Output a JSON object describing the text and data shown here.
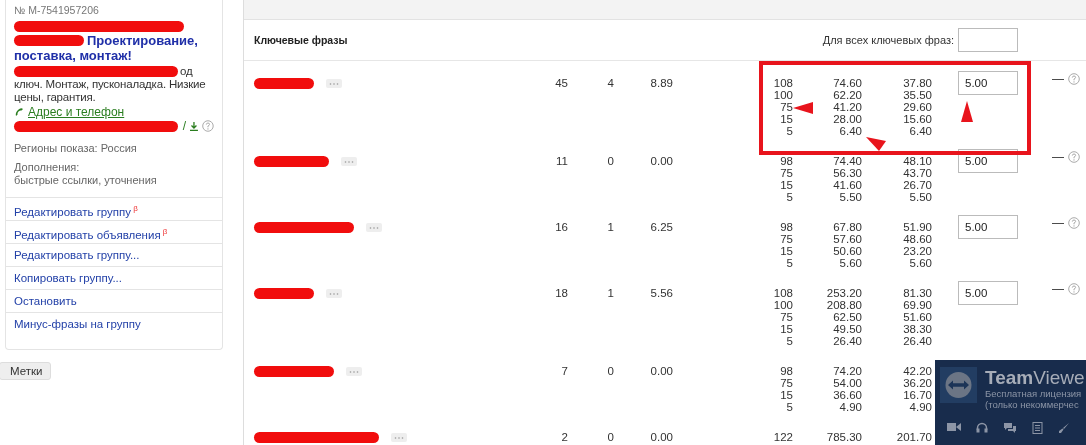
{
  "ad": {
    "number": "№ M-7541957206",
    "title": "Проектирование, поставка, монтаж!",
    "body_fragment": "од",
    "body": "ключ. Монтаж, пусконаладка. Низкие цены, гарантия.",
    "address_link": "Адрес и телефон",
    "phone_suffix": "/",
    "regions": "Регионы показа: Россия",
    "extras_label": "Дополнения:",
    "extras_value": "быстрые ссылки, уточнения"
  },
  "menu": [
    {
      "label": "Редактировать группу",
      "badge": "β"
    },
    {
      "label": "Редактировать объявления",
      "badge": "β"
    },
    {
      "label": "Редактировать группу..."
    },
    {
      "label": "Копировать группу..."
    },
    {
      "label": "Остановить"
    },
    {
      "label": "Минус-фразы на группу"
    }
  ],
  "tags_button": "Метки",
  "table": {
    "keywords_heading": "Ключевые фразы",
    "all_bid_label": "Для всех ключевых фраз:",
    "rows": [
      {
        "shows": "45",
        "clicks": "4",
        "ctr": "8.89",
        "bid": "5.00",
        "status": "—",
        "positions": [
          [
            "108",
            "74.60",
            "37.80"
          ],
          [
            "100",
            "62.20",
            "35.50"
          ],
          [
            "75",
            "41.20",
            "29.60"
          ],
          [
            "15",
            "28.00",
            "15.60"
          ],
          [
            "5",
            "6.40",
            "6.40"
          ]
        ]
      },
      {
        "shows": "11",
        "clicks": "0",
        "ctr": "0.00",
        "bid": "5.00",
        "status": "—",
        "positions": [
          [
            "98",
            "74.40",
            "48.10"
          ],
          [
            "75",
            "56.30",
            "43.70"
          ],
          [
            "15",
            "41.60",
            "26.70"
          ],
          [
            "5",
            "5.50",
            "5.50"
          ]
        ]
      },
      {
        "shows": "16",
        "clicks": "1",
        "ctr": "6.25",
        "bid": "5.00",
        "status": "—",
        "positions": [
          [
            "98",
            "67.80",
            "51.90"
          ],
          [
            "75",
            "57.60",
            "48.60"
          ],
          [
            "15",
            "50.60",
            "23.20"
          ],
          [
            "5",
            "5.60",
            "5.60"
          ]
        ]
      },
      {
        "shows": "18",
        "clicks": "1",
        "ctr": "5.56",
        "bid": "5.00",
        "status": "—",
        "positions": [
          [
            "108",
            "253.20",
            "81.30"
          ],
          [
            "100",
            "208.80",
            "69.90"
          ],
          [
            "75",
            "62.50",
            "51.60"
          ],
          [
            "15",
            "49.50",
            "38.30"
          ],
          [
            "5",
            "26.40",
            "26.40"
          ]
        ]
      },
      {
        "shows": "7",
        "clicks": "0",
        "ctr": "0.00",
        "positions": [
          [
            "98",
            "74.20",
            "42.20"
          ],
          [
            "75",
            "54.00",
            "36.20"
          ],
          [
            "15",
            "36.60",
            "16.70"
          ],
          [
            "5",
            "4.90",
            "4.90"
          ]
        ]
      },
      {
        "shows": "2",
        "clicks": "0",
        "ctr": "0.00",
        "positions": [
          [
            "122",
            "785.30",
            "201.70"
          ]
        ]
      }
    ]
  },
  "teamviewer": {
    "title_bold": "Team",
    "title_light": "Viewe",
    "line1": "Бесплатная лицензия",
    "line2": "(только некоммерчес"
  }
}
